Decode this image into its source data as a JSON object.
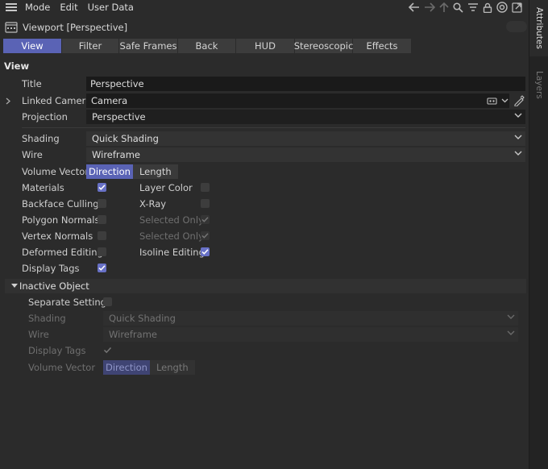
{
  "menubar": {
    "items": [
      "Mode",
      "Edit",
      "User Data"
    ]
  },
  "titlebar": {
    "title": "Viewport [Perspective]"
  },
  "tabs": [
    "View",
    "Filter",
    "Safe Frames",
    "Back",
    "HUD",
    "Stereoscopic",
    "Effects"
  ],
  "active_tab": "View",
  "section": "View",
  "fields": {
    "title_label": "Title",
    "title_value": "Perspective",
    "linked_camera_label": "Linked Camera",
    "linked_camera_value": "Camera",
    "projection_label": "Projection",
    "projection_value": "Perspective",
    "shading_label": "Shading",
    "shading_value": "Quick Shading",
    "wire_label": "Wire",
    "wire_value": "Wireframe",
    "volume_vector_label": "Volume Vector",
    "volume_vector_options": [
      "Direction",
      "Length"
    ],
    "volume_vector_selected": "Direction"
  },
  "checks": {
    "materials": {
      "label": "Materials",
      "checked": true
    },
    "layer_color": {
      "label": "Layer Color",
      "checked": false
    },
    "backface_culling": {
      "label": "Backface Culling",
      "checked": false
    },
    "xray": {
      "label": "X-Ray",
      "checked": false
    },
    "polygon_normals": {
      "label": "Polygon Normals",
      "checked": false
    },
    "selected_only_1": {
      "label": "Selected Only",
      "checked": true,
      "disabled": true
    },
    "vertex_normals": {
      "label": "Vertex Normals",
      "checked": false
    },
    "selected_only_2": {
      "label": "Selected Only",
      "checked": true,
      "disabled": true
    },
    "deformed_editing": {
      "label": "Deformed Editing",
      "checked": false
    },
    "isoline_editing": {
      "label": "Isoline Editing",
      "checked": true
    },
    "display_tags": {
      "label": "Display Tags",
      "checked": true
    }
  },
  "inactive": {
    "header": "Inactive Object",
    "separate_settings_label": "Separate Settings",
    "shading_label": "Shading",
    "shading_value": "Quick Shading",
    "wire_label": "Wire",
    "wire_value": "Wireframe",
    "display_tags_label": "Display Tags",
    "volume_vector_label": "Volume Vector",
    "volume_vector_options": [
      "Direction",
      "Length"
    ]
  },
  "side_tabs": [
    "Attributes",
    "Layers"
  ],
  "colors": {
    "accent": "#5a63b5",
    "background": "#2b2b2b",
    "checkbox_on": "#6871c6"
  }
}
